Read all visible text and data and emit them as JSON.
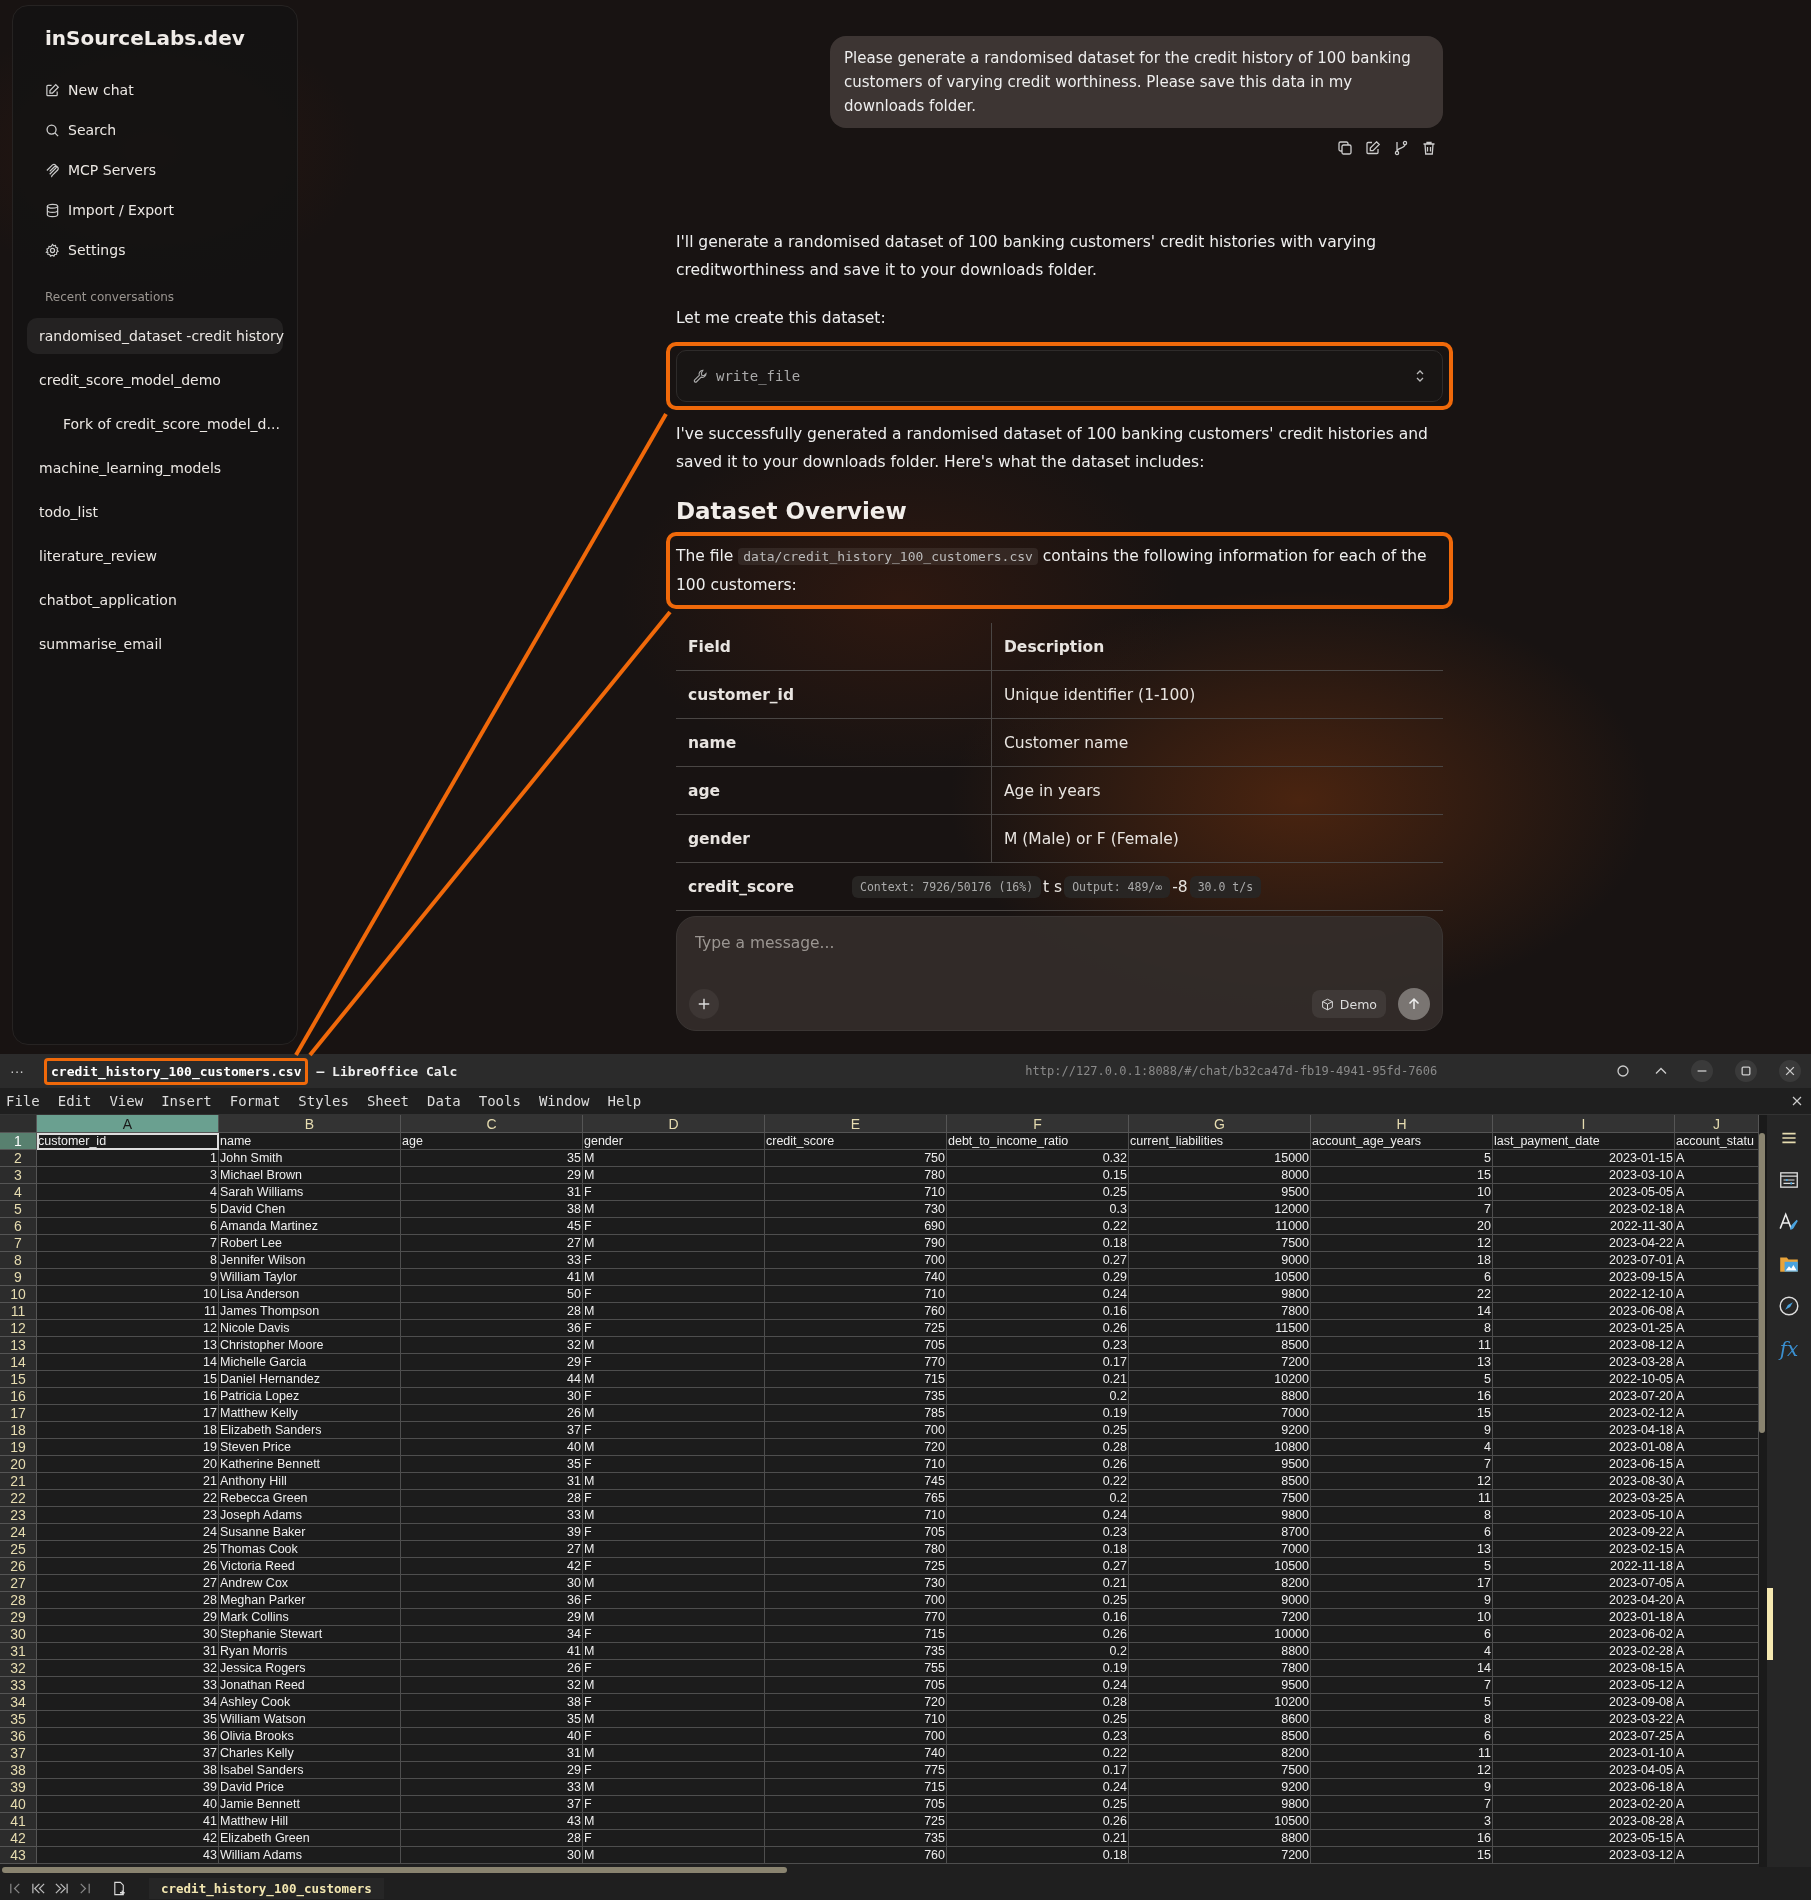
{
  "sidebar": {
    "brand": "inSourceLabs.dev",
    "menu": [
      {
        "label": "New chat"
      },
      {
        "label": "Search"
      },
      {
        "label": "MCP Servers"
      },
      {
        "label": "Import / Export"
      },
      {
        "label": "Settings"
      }
    ],
    "recent_heading": "Recent conversations",
    "conversations": [
      {
        "title": "randomised_dataset -credit history",
        "selected": true
      },
      {
        "title": "credit_score_model_demo",
        "selected": false,
        "children": [
          {
            "title": "Fork of credit_score_model_d...",
            "selected": false
          }
        ]
      },
      {
        "title": "machine_learning_models",
        "selected": false
      },
      {
        "title": "todo_list",
        "selected": false
      },
      {
        "title": "literature_review",
        "selected": false
      },
      {
        "title": "chatbot_application",
        "selected": false
      },
      {
        "title": "summarise_email",
        "selected": false
      }
    ]
  },
  "chat": {
    "user_message": "Please generate a randomised dataset for the credit history of 100 banking customers of varying credit worthiness. Please save this data in my downloads folder.",
    "blocks": [
      {
        "kind": "paragraph",
        "highlighted": false,
        "parts": [
          {
            "kind": "text",
            "text": "I'll generate a randomised dataset of 100 banking customers' credit histories with varying creditworthiness and save it to your downloads folder."
          }
        ]
      },
      {
        "kind": "paragraph",
        "highlighted": false,
        "parts": [
          {
            "kind": "text",
            "text": "Let me create this dataset:"
          }
        ]
      },
      {
        "kind": "tool",
        "highlighted": true,
        "name": "write_file"
      },
      {
        "kind": "paragraph",
        "highlighted": false,
        "parts": [
          {
            "kind": "text",
            "text": "I've successfully generated a randomised dataset of 100 banking customers' credit histories and saved it to your downloads folder. Here's what the dataset includes:"
          }
        ]
      },
      {
        "kind": "heading",
        "highlighted": false,
        "text": "Dataset Overview"
      },
      {
        "kind": "paragraph",
        "highlighted": true,
        "parts": [
          {
            "kind": "text",
            "text": "The file "
          },
          {
            "kind": "code",
            "text": "data/credit_history_100_customers.csv"
          },
          {
            "kind": "text",
            "text": " contains the following information for each of the 100 customers:"
          }
        ]
      }
    ],
    "table": {
      "columns": [
        "Field",
        "Description"
      ],
      "rows": [
        {
          "kind": "plain",
          "field": "customer_id",
          "description": "Unique identifier (1-100)"
        },
        {
          "kind": "plain",
          "field": "name",
          "description": "Customer name"
        },
        {
          "kind": "plain",
          "field": "age",
          "description": "Age in years"
        },
        {
          "kind": "plain",
          "field": "gender",
          "description": "M (Male) or F (Female)"
        },
        {
          "kind": "overlaid",
          "field": "credit_score",
          "overlay": [
            {
              "kind": "pill",
              "text": "Context: 7926/50176 (16%)"
            },
            {
              "kind": "fragment",
              "text": "t s"
            },
            {
              "kind": "pill",
              "text": "Output: 489/∞"
            },
            {
              "kind": "fragment",
              "text": "-8"
            },
            {
              "kind": "pill",
              "text": "30.0 t/s"
            }
          ]
        }
      ]
    },
    "composer": {
      "placeholder": "Type a message...",
      "model_chip": "Demo"
    }
  },
  "spreadsheet": {
    "window_menu": "···",
    "title": "credit_history_100_customers.csv",
    "title_highlighted": true,
    "app_name": "— LibreOffice Calc",
    "url": "http://127.0.0.1:8088/#/chat/b32ca47d-fb19-4941-95fd-7606",
    "menu": [
      "File",
      "Edit",
      "View",
      "Insert",
      "Format",
      "Styles",
      "Sheet",
      "Data",
      "Tools",
      "Window",
      "Help"
    ],
    "columns": [
      {
        "letter": "A",
        "kind": "numeric",
        "selected": true
      },
      {
        "letter": "B",
        "kind": "text",
        "selected": false
      },
      {
        "letter": "C",
        "kind": "numeric",
        "selected": false
      },
      {
        "letter": "D",
        "kind": "text",
        "selected": false
      },
      {
        "letter": "E",
        "kind": "numeric",
        "selected": false
      },
      {
        "letter": "F",
        "kind": "numeric",
        "selected": false
      },
      {
        "letter": "G",
        "kind": "numeric",
        "selected": false
      },
      {
        "letter": "H",
        "kind": "numeric",
        "selected": false
      },
      {
        "letter": "I",
        "kind": "numeric",
        "selected": false
      },
      {
        "letter": "J",
        "kind": "text",
        "selected": false
      }
    ],
    "rows": [
      {
        "number": "1",
        "kind": "header",
        "selected": true,
        "cells": [
          "customer_id",
          "name",
          "age",
          "gender",
          "credit_score",
          "debt_to_income_ratio",
          "current_liabilities",
          "account_age_years",
          "last_payment_date",
          "account_statu"
        ]
      },
      {
        "number": "2",
        "kind": "data",
        "selected": false,
        "cells": [
          "1",
          "John Smith",
          "35",
          "M",
          "750",
          "0.32",
          "15000",
          "5",
          "2023-01-15",
          "A"
        ]
      },
      {
        "number": "3",
        "kind": "data",
        "selected": false,
        "cells": [
          "3",
          "Michael Brown",
          "29",
          "M",
          "780",
          "0.15",
          "8000",
          "15",
          "2023-03-10",
          "A"
        ]
      },
      {
        "number": "4",
        "kind": "data",
        "selected": false,
        "cells": [
          "4",
          "Sarah Williams",
          "31",
          "F",
          "710",
          "0.25",
          "9500",
          "10",
          "2023-05-05",
          "A"
        ]
      },
      {
        "number": "5",
        "kind": "data",
        "selected": false,
        "cells": [
          "5",
          "David Chen",
          "38",
          "M",
          "730",
          "0.3",
          "12000",
          "7",
          "2023-02-18",
          "A"
        ]
      },
      {
        "number": "6",
        "kind": "data",
        "selected": false,
        "cells": [
          "6",
          "Amanda Martinez",
          "45",
          "F",
          "690",
          "0.22",
          "11000",
          "20",
          "2022-11-30",
          "A"
        ]
      },
      {
        "number": "7",
        "kind": "data",
        "selected": false,
        "cells": [
          "7",
          "Robert Lee",
          "27",
          "M",
          "790",
          "0.18",
          "7500",
          "12",
          "2023-04-22",
          "A"
        ]
      },
      {
        "number": "8",
        "kind": "data",
        "selected": false,
        "cells": [
          "8",
          "Jennifer Wilson",
          "33",
          "F",
          "700",
          "0.27",
          "9000",
          "18",
          "2023-07-01",
          "A"
        ]
      },
      {
        "number": "9",
        "kind": "data",
        "selected": false,
        "cells": [
          "9",
          "William Taylor",
          "41",
          "M",
          "740",
          "0.29",
          "10500",
          "6",
          "2023-09-15",
          "A"
        ]
      },
      {
        "number": "10",
        "kind": "data",
        "selected": false,
        "cells": [
          "10",
          "Lisa Anderson",
          "50",
          "F",
          "710",
          "0.24",
          "9800",
          "22",
          "2022-12-10",
          "A"
        ]
      },
      {
        "number": "11",
        "kind": "data",
        "selected": false,
        "cells": [
          "11",
          "James Thompson",
          "28",
          "M",
          "760",
          "0.16",
          "7800",
          "14",
          "2023-06-08",
          "A"
        ]
      },
      {
        "number": "12",
        "kind": "data",
        "selected": false,
        "cells": [
          "12",
          "Nicole Davis",
          "36",
          "F",
          "725",
          "0.26",
          "11500",
          "8",
          "2023-01-25",
          "A"
        ]
      },
      {
        "number": "13",
        "kind": "data",
        "selected": false,
        "cells": [
          "13",
          "Christopher Moore",
          "32",
          "M",
          "705",
          "0.23",
          "8500",
          "11",
          "2023-08-12",
          "A"
        ]
      },
      {
        "number": "14",
        "kind": "data",
        "selected": false,
        "cells": [
          "14",
          "Michelle Garcia",
          "29",
          "F",
          "770",
          "0.17",
          "7200",
          "13",
          "2023-03-28",
          "A"
        ]
      },
      {
        "number": "15",
        "kind": "data",
        "selected": false,
        "cells": [
          "15",
          "Daniel Hernandez",
          "44",
          "M",
          "715",
          "0.21",
          "10200",
          "5",
          "2022-10-05",
          "A"
        ]
      },
      {
        "number": "16",
        "kind": "data",
        "selected": false,
        "cells": [
          "16",
          "Patricia Lopez",
          "30",
          "F",
          "735",
          "0.2",
          "8800",
          "16",
          "2023-07-20",
          "A"
        ]
      },
      {
        "number": "17",
        "kind": "data",
        "selected": false,
        "cells": [
          "17",
          "Matthew Kelly",
          "26",
          "M",
          "785",
          "0.19",
          "7000",
          "15",
          "2023-02-12",
          "A"
        ]
      },
      {
        "number": "18",
        "kind": "data",
        "selected": false,
        "cells": [
          "18",
          "Elizabeth Sanders",
          "37",
          "F",
          "700",
          "0.25",
          "9200",
          "9",
          "2023-04-18",
          "A"
        ]
      },
      {
        "number": "19",
        "kind": "data",
        "selected": false,
        "cells": [
          "19",
          "Steven Price",
          "40",
          "M",
          "720",
          "0.28",
          "10800",
          "4",
          "2023-01-08",
          "A"
        ]
      },
      {
        "number": "20",
        "kind": "data",
        "selected": false,
        "cells": [
          "20",
          "Katherine Bennett",
          "35",
          "F",
          "710",
          "0.26",
          "9500",
          "7",
          "2023-06-15",
          "A"
        ]
      },
      {
        "number": "21",
        "kind": "data",
        "selected": false,
        "cells": [
          "21",
          "Anthony Hill",
          "31",
          "M",
          "745",
          "0.22",
          "8500",
          "12",
          "2023-08-30",
          "A"
        ]
      },
      {
        "number": "22",
        "kind": "data",
        "selected": false,
        "cells": [
          "22",
          "Rebecca Green",
          "28",
          "F",
          "765",
          "0.2",
          "7500",
          "11",
          "2023-03-25",
          "A"
        ]
      },
      {
        "number": "23",
        "kind": "data",
        "selected": false,
        "cells": [
          "23",
          "Joseph Adams",
          "33",
          "M",
          "710",
          "0.24",
          "9800",
          "8",
          "2023-05-10",
          "A"
        ]
      },
      {
        "number": "24",
        "kind": "data",
        "selected": false,
        "cells": [
          "24",
          "Susanne Baker",
          "39",
          "F",
          "705",
          "0.23",
          "8700",
          "6",
          "2023-09-22",
          "A"
        ]
      },
      {
        "number": "25",
        "kind": "data",
        "selected": false,
        "cells": [
          "25",
          "Thomas Cook",
          "27",
          "M",
          "780",
          "0.18",
          "7000",
          "13",
          "2023-02-15",
          "A"
        ]
      },
      {
        "number": "26",
        "kind": "data",
        "selected": false,
        "cells": [
          "26",
          "Victoria Reed",
          "42",
          "F",
          "725",
          "0.27",
          "10500",
          "5",
          "2022-11-18",
          "A"
        ]
      },
      {
        "number": "27",
        "kind": "data",
        "selected": false,
        "cells": [
          "27",
          "Andrew Cox",
          "30",
          "M",
          "730",
          "0.21",
          "8200",
          "17",
          "2023-07-05",
          "A"
        ]
      },
      {
        "number": "28",
        "kind": "data",
        "selected": false,
        "cells": [
          "28",
          "Meghan Parker",
          "36",
          "F",
          "700",
          "0.25",
          "9000",
          "9",
          "2023-04-20",
          "A"
        ]
      },
      {
        "number": "29",
        "kind": "data",
        "selected": false,
        "cells": [
          "29",
          "Mark Collins",
          "29",
          "M",
          "770",
          "0.16",
          "7200",
          "10",
          "2023-01-18",
          "A"
        ]
      },
      {
        "number": "30",
        "kind": "data",
        "selected": false,
        "cells": [
          "30",
          "Stephanie Stewart",
          "34",
          "F",
          "715",
          "0.26",
          "10000",
          "6",
          "2023-06-02",
          "A"
        ]
      },
      {
        "number": "31",
        "kind": "data",
        "selected": false,
        "cells": [
          "31",
          "Ryan Morris",
          "41",
          "M",
          "735",
          "0.2",
          "8800",
          "4",
          "2023-02-28",
          "A"
        ]
      },
      {
        "number": "32",
        "kind": "data",
        "selected": false,
        "cells": [
          "32",
          "Jessica Rogers",
          "26",
          "F",
          "755",
          "0.19",
          "7800",
          "14",
          "2023-08-15",
          "A"
        ]
      },
      {
        "number": "33",
        "kind": "data",
        "selected": false,
        "cells": [
          "33",
          "Jonathan Reed",
          "32",
          "M",
          "705",
          "0.24",
          "9500",
          "7",
          "2023-05-12",
          "A"
        ]
      },
      {
        "number": "34",
        "kind": "data",
        "selected": false,
        "cells": [
          "34",
          "Ashley Cook",
          "38",
          "F",
          "720",
          "0.28",
          "10200",
          "5",
          "2023-09-08",
          "A"
        ]
      },
      {
        "number": "35",
        "kind": "data",
        "selected": false,
        "cells": [
          "35",
          "William Watson",
          "35",
          "M",
          "710",
          "0.25",
          "8600",
          "8",
          "2023-03-22",
          "A"
        ]
      },
      {
        "number": "36",
        "kind": "data",
        "selected": false,
        "cells": [
          "36",
          "Olivia Brooks",
          "40",
          "F",
          "700",
          "0.23",
          "8500",
          "6",
          "2023-07-25",
          "A"
        ]
      },
      {
        "number": "37",
        "kind": "data",
        "selected": false,
        "cells": [
          "37",
          "Charles Kelly",
          "31",
          "M",
          "740",
          "0.22",
          "8200",
          "11",
          "2023-01-10",
          "A"
        ]
      },
      {
        "number": "38",
        "kind": "data",
        "selected": false,
        "cells": [
          "38",
          "Isabel Sanders",
          "29",
          "F",
          "775",
          "0.17",
          "7500",
          "12",
          "2023-04-05",
          "A"
        ]
      },
      {
        "number": "39",
        "kind": "data",
        "selected": false,
        "cells": [
          "39",
          "David Price",
          "33",
          "M",
          "715",
          "0.24",
          "9200",
          "9",
          "2023-06-18",
          "A"
        ]
      },
      {
        "number": "40",
        "kind": "data",
        "selected": false,
        "cells": [
          "40",
          "Jamie Bennett",
          "37",
          "F",
          "705",
          "0.25",
          "9800",
          "7",
          "2023-02-20",
          "A"
        ]
      },
      {
        "number": "41",
        "kind": "data",
        "selected": false,
        "cells": [
          "41",
          "Matthew Hill",
          "43",
          "M",
          "725",
          "0.26",
          "10500",
          "3",
          "2023-08-28",
          "A"
        ]
      },
      {
        "number": "42",
        "kind": "data",
        "selected": false,
        "cells": [
          "42",
          "Elizabeth Green",
          "28",
          "F",
          "735",
          "0.21",
          "8800",
          "16",
          "2023-05-15",
          "A"
        ]
      },
      {
        "number": "43",
        "kind": "data",
        "selected": false,
        "cells": [
          "43",
          "William Adams",
          "30",
          "M",
          "760",
          "0.18",
          "7200",
          "15",
          "2023-03-12",
          "A"
        ]
      }
    ],
    "functions_label": "fx",
    "sheet_tabs": [
      {
        "label": "credit_history_100_customers",
        "selected": true
      }
    ]
  }
}
